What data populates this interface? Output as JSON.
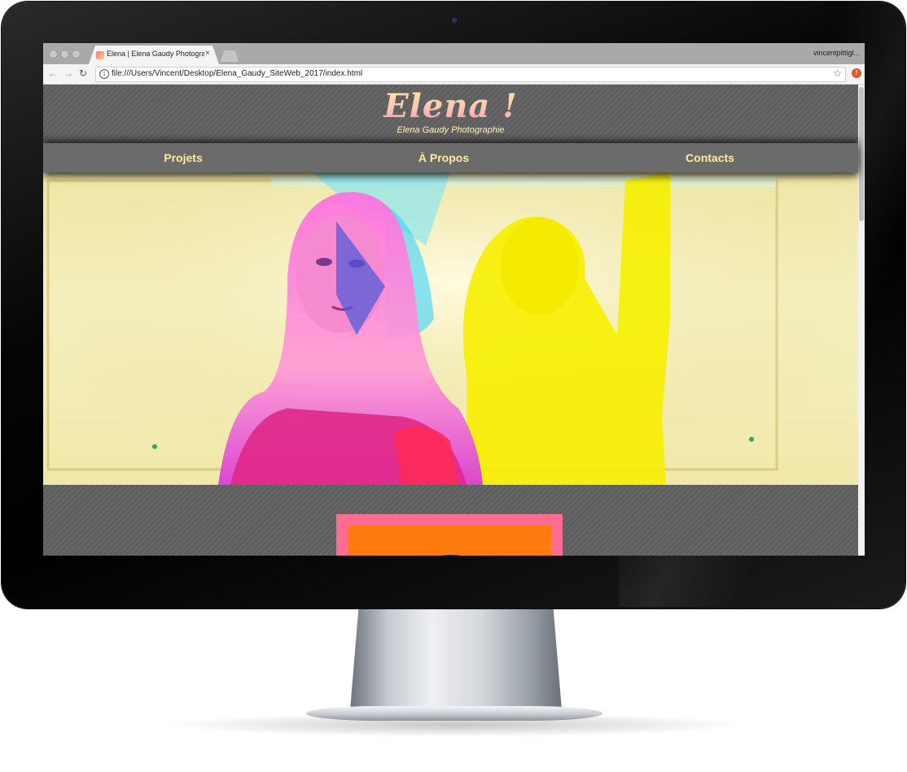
{
  "browser": {
    "tab_title": "Elena | Elena Gaudy Photograp",
    "tab_close": "×",
    "profile_name": "vincentpittigl...",
    "url": "file:///Users/Vincent/Desktop/Elena_Gaudy_SiteWeb_2017/index.html",
    "back_glyph": "←",
    "forward_glyph": "→",
    "reload_glyph": "↻",
    "info_glyph": "i",
    "star_glyph": "☆",
    "extension_glyph": "!"
  },
  "site": {
    "logo": "Elena !",
    "tagline": "Elena Gaudy Photographie",
    "nav": [
      {
        "label": "Projets"
      },
      {
        "label": "À Propos"
      },
      {
        "label": "Contacts"
      }
    ]
  },
  "colors": {
    "nav_text": "#ffe9a3",
    "card_border": "#ff6c92",
    "card_fill": "#ff7b0f"
  },
  "icons": {
    "tab": "favicon-icon",
    "close": "close-icon",
    "info": "info-icon",
    "bookmark": "star-icon",
    "extension": "extension-icon"
  }
}
